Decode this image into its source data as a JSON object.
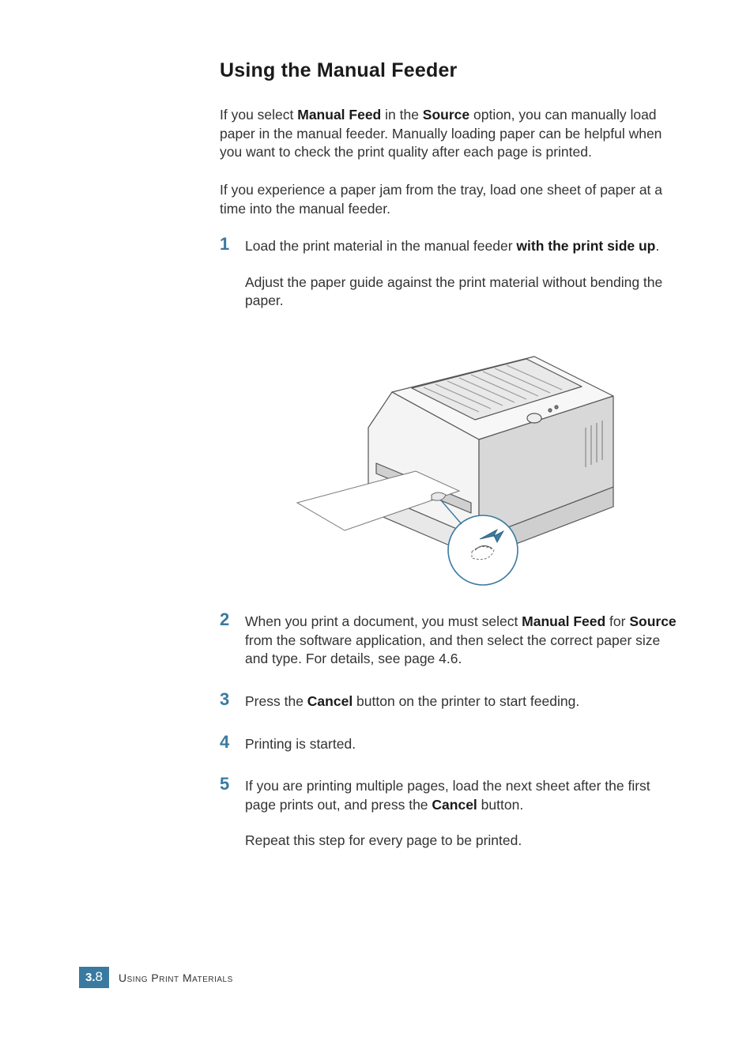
{
  "heading": "Using the Manual Feeder",
  "intro": {
    "p1": {
      "pre": "If you select ",
      "b1": "Manual Feed",
      "mid": " in the ",
      "b2": "Source",
      "post": " option, you can manually load paper in the manual feeder. Manually loading paper can be helpful when you want to check the print quality after each page is printed."
    },
    "p2": "If you experience a paper jam from the tray, load one sheet of paper at a time into the manual feeder."
  },
  "steps": {
    "s1": {
      "num": "1",
      "l1": {
        "pre": "Load the print material in the manual feeder ",
        "b1": "with the print side up",
        "post": "."
      },
      "l2": "Adjust the paper guide against the print material without bending the paper."
    },
    "s2": {
      "num": "2",
      "pre": "When you print a document, you must select ",
      "b1": "Manual Feed",
      "mid": " for ",
      "b2": "Source",
      "post": " from the software application, and then select the correct paper size and type. For details, see page 4.6."
    },
    "s3": {
      "num": "3",
      "pre": "Press the ",
      "b1": "Cancel",
      "post": " button on the printer to start feeding."
    },
    "s4": {
      "num": "4",
      "text": "Printing is started."
    },
    "s5": {
      "num": "5",
      "pre": "If you are printing multiple pages, load the next sheet after the first page prints out, and press the ",
      "b1": "Cancel",
      "post": " button.",
      "l2": "Repeat this step for every page to be printed."
    }
  },
  "footer": {
    "chapter": "3.",
    "page": "8",
    "label": "Using Print Materials"
  },
  "figure_alt": "printer-manual-feeder-diagram"
}
